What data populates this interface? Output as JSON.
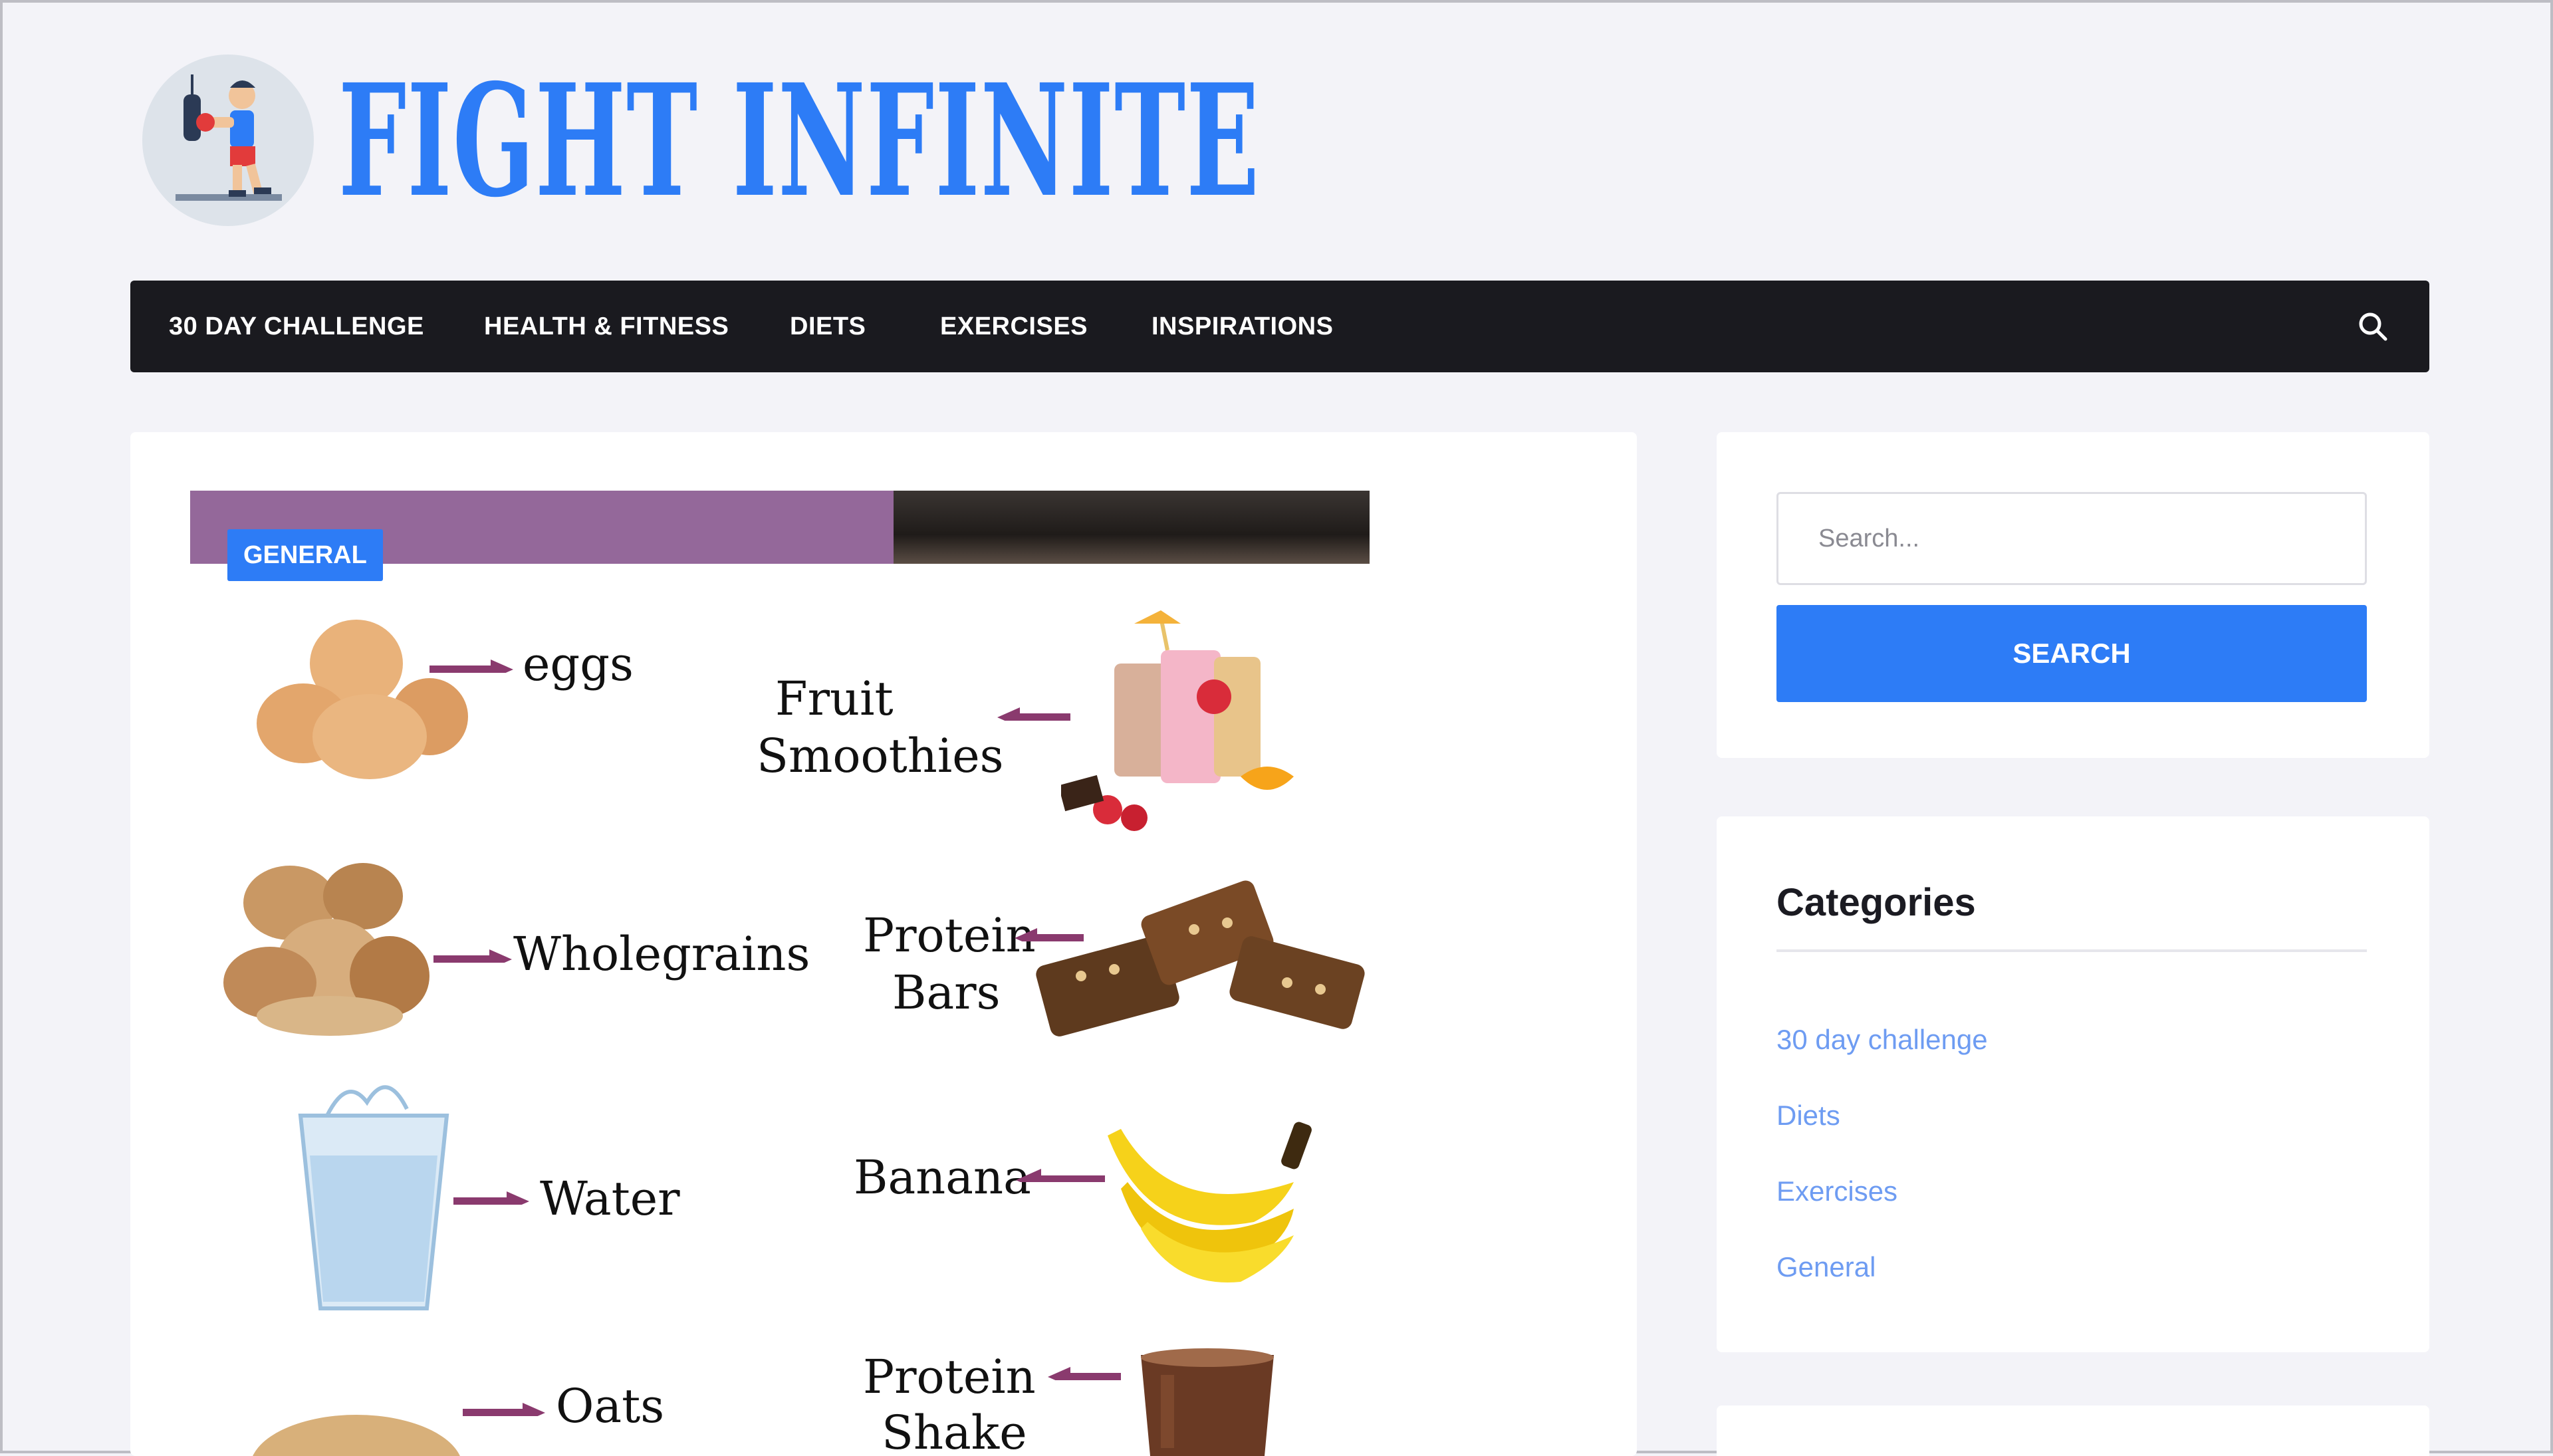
{
  "site": {
    "title": "FIGHT INFINITE"
  },
  "nav": {
    "items": [
      "30 DAY CHALLENGE",
      "HEALTH & FITNESS",
      "DIETS",
      "EXERCISES",
      "INSPIRATIONS"
    ]
  },
  "post": {
    "category_badge": "GENERAL",
    "foods": {
      "eggs": "eggs",
      "smoothies_line1": "Fruit",
      "smoothies_line2": "Smoothies",
      "wholegrains": "Wholegrains",
      "bars_line1": "Protein",
      "bars_line2": "Bars",
      "water": "Water",
      "banana": "Banana",
      "oats": "Oats",
      "shake_line1": "Protein",
      "shake_line2": "Shake"
    }
  },
  "sidebar": {
    "search": {
      "placeholder": "Search...",
      "button_label": "SEARCH"
    },
    "categories": {
      "title": "Categories",
      "items": [
        "30 day challenge",
        "Diets",
        "Exercises",
        "General"
      ]
    }
  },
  "colors": {
    "brand_blue": "#2d7cf6",
    "nav_background": "#1a1a1f",
    "arrow_purple": "#8a3a6e",
    "page_background": "#f3f3f8"
  }
}
